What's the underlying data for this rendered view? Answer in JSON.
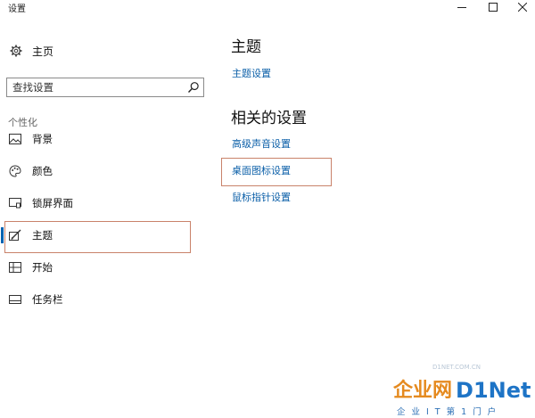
{
  "window": {
    "title": "设置",
    "controls": {
      "minimize": "minimize",
      "maximize": "maximize",
      "close": "close"
    }
  },
  "sidebar": {
    "home_label": "主页",
    "search": {
      "placeholder": "查找设置",
      "value": ""
    },
    "section_title": "个性化",
    "items": [
      {
        "label": "背景",
        "icon": "picture-icon",
        "active": false
      },
      {
        "label": "颜色",
        "icon": "palette-icon",
        "active": false
      },
      {
        "label": "锁屏界面",
        "icon": "lock-screen-icon",
        "active": false
      },
      {
        "label": "主题",
        "icon": "theme-brush-icon",
        "active": true
      },
      {
        "label": "开始",
        "icon": "start-tiles-icon",
        "active": false
      },
      {
        "label": "任务栏",
        "icon": "taskbar-icon",
        "active": false
      }
    ]
  },
  "content": {
    "title": "主题",
    "theme_settings_link": "主题设置",
    "related_title": "相关的设置",
    "related_links": [
      "高级声音设置",
      "桌面图标设置",
      "鼠标指针设置"
    ]
  },
  "watermark": {
    "cn": "企业网",
    "en": "D1Net",
    "sub": "企业IT第1门户",
    "url": "D1NET.COM.CN"
  },
  "colors": {
    "accent": "#0063b1",
    "link": "#0b5fa8",
    "annotation_box": "#c9826a",
    "watermark_orange": "#e58a1f",
    "watermark_blue": "#1e74c6"
  }
}
